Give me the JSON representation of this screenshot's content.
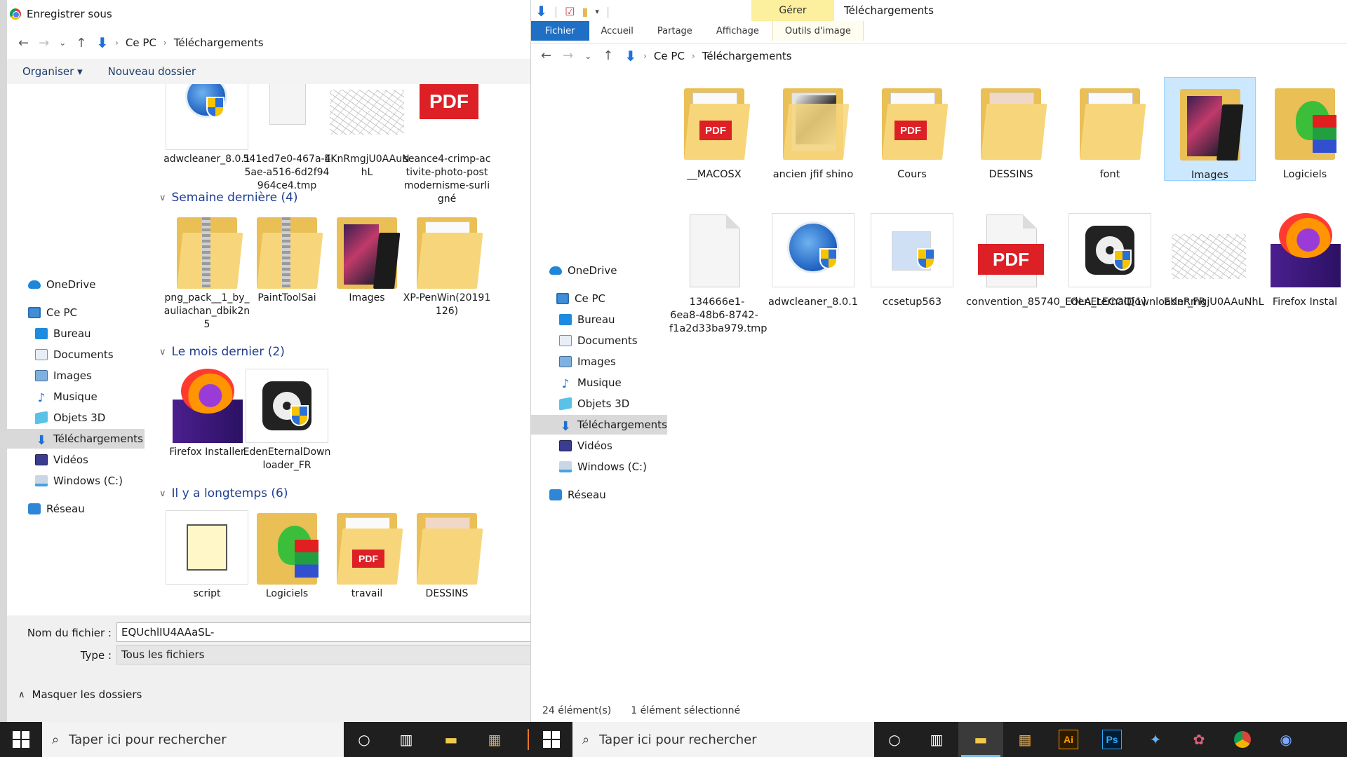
{
  "dialog": {
    "title": "Enregistrer sous",
    "breadcrumb": [
      "Ce PC",
      "Téléchargements"
    ],
    "toolbar": {
      "organize": "Organiser",
      "new_folder": "Nouveau dossier"
    },
    "nav": {
      "onedrive": "OneDrive",
      "pc": "Ce PC",
      "items": [
        "Bureau",
        "Documents",
        "Images",
        "Musique",
        "Objets 3D",
        "Téléchargements",
        "Vidéos",
        "Windows (C:)"
      ],
      "network": "Réseau"
    },
    "top_row": [
      "adwcleaner_8.0.1",
      "541ed7e0-467a-45ae-a516-6d2f94964ce4.tmp",
      "EKnRmgjU0AAuNhL",
      "seance4-crimp-activite-photo-postmodernisme-surligné"
    ],
    "groups": [
      {
        "header": "Semaine dernière (4)",
        "items": [
          "png_pack__1_by_auliachan_dbik2n5",
          "PaintToolSai",
          "Images",
          "XP-PenWin(20191126)"
        ]
      },
      {
        "header": "Le mois dernier (2)",
        "items": [
          "Firefox Installer",
          "EdenEternalDownloader_FR"
        ]
      },
      {
        "header": "Il y a longtemps (6)",
        "items": [
          "script",
          "Logiciels",
          "travail",
          "DESSINS"
        ]
      }
    ],
    "pdf_badge": "PDF",
    "filename_label": "Nom du fichier :",
    "filename_value": "EQUchlIU4AAaSL-",
    "type_label": "Type :",
    "type_value": "Tous les fichiers",
    "hide_folders": "Masquer les dossiers"
  },
  "explorer": {
    "context_tab": "Gérer",
    "window_title": "Téléchargements",
    "tabs": [
      "Fichier",
      "Accueil",
      "Partage",
      "Affichage",
      "Outils d'image"
    ],
    "breadcrumb": [
      "Ce PC",
      "Téléchargements"
    ],
    "nav": {
      "onedrive": "OneDrive",
      "pc": "Ce PC",
      "items": [
        "Bureau",
        "Documents",
        "Images",
        "Musique",
        "Objets 3D",
        "Téléchargements",
        "Vidéos",
        "Windows (C:)"
      ],
      "network": "Réseau"
    },
    "row1": [
      "__MACOSX",
      "ancien jfif shino",
      "Cours",
      "DESSINS",
      "font",
      "Images",
      "Logiciels"
    ],
    "row2": [
      "134666e1-6ea8-48b6-8742-f1a2d33ba979.tmp",
      "adwcleaner_8.0.1",
      "ccsetup563",
      "convention_85740_LOLA_LECOQ[1]",
      "EdenEternalDownloader_FR",
      "EKnRmgjU0AAuNhL",
      "Firefox Instal"
    ],
    "pdf_badge": "PDF",
    "status_count": "24 élément(s)",
    "status_selected": "1 élément sélectionné"
  },
  "taskbar": {
    "search_placeholder": "Taper ici pour rechercher",
    "search_placeholder_2": "Taper ici pour rechercher",
    "ai_label": "Ai",
    "ps_label": "Ps"
  },
  "colors": {
    "accent": "#1f6fc4",
    "selection": "#cce8ff",
    "context_tab": "#fcef9e",
    "taskbar": "#1f1f1f"
  }
}
